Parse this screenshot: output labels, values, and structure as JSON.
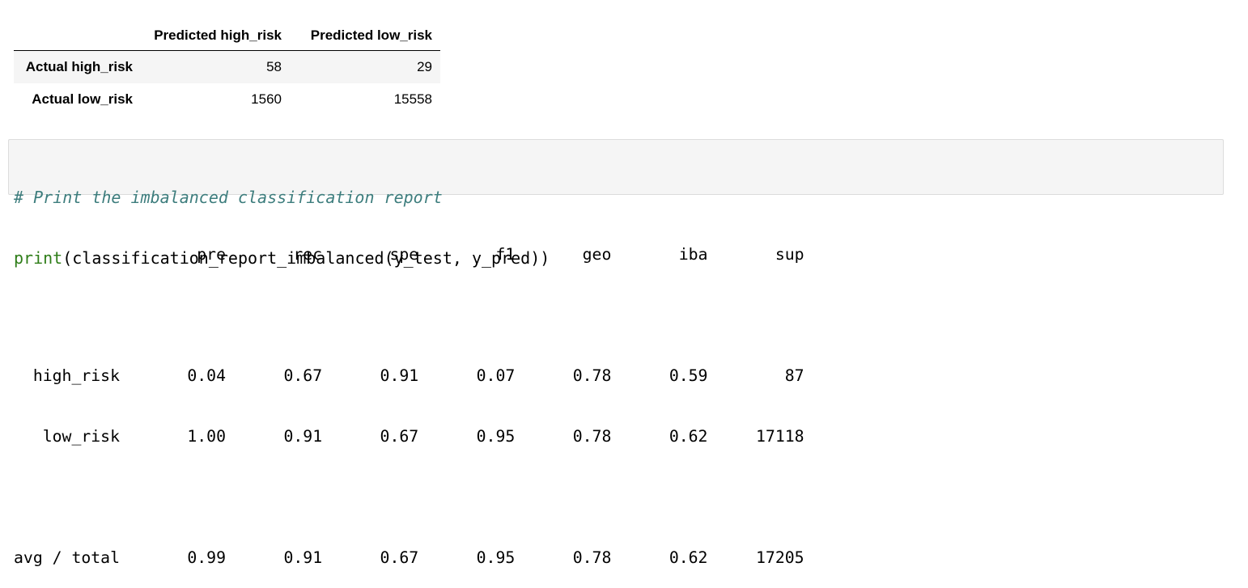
{
  "confusion_matrix": {
    "columns": [
      "Predicted high_risk",
      "Predicted low_risk"
    ],
    "rows": [
      {
        "label": "Actual high_risk",
        "values": [
          "58",
          "29"
        ]
      },
      {
        "label": "Actual low_risk",
        "values": [
          "1560",
          "15558"
        ]
      }
    ]
  },
  "code_cell": {
    "comment": "# Print the imbalanced classification report",
    "builtin": "print",
    "rest": "(classification_report_imbalanced(y_test, y_pred))"
  },
  "report": {
    "lines": [
      "                   pre       rec       spe        f1       geo       iba       sup",
      "",
      "  high_risk       0.04      0.67      0.91      0.07      0.78      0.59        87",
      "   low_risk       1.00      0.91      0.67      0.95      0.78      0.62     17118",
      "",
      "avg / total       0.99      0.91      0.67      0.95      0.78      0.62     17205"
    ]
  },
  "colors": {
    "comment": "#3d7d7d",
    "builtin": "#2e7d18",
    "cell_background": "#f5f5f5",
    "cell_border": "#dcdcdc",
    "row_stripe": "#f5f5f5"
  }
}
